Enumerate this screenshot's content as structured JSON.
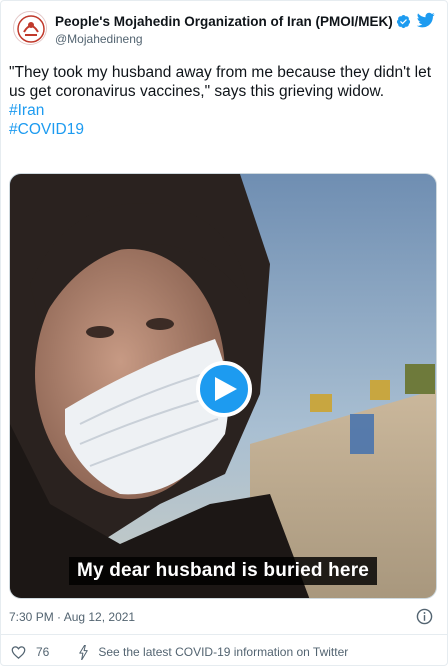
{
  "author": {
    "display_name": "People's Mojahedin Organization of Iran (PMOI/MEK)",
    "handle": "@Mojahedineng",
    "verified": true
  },
  "tweet": {
    "text": "\"They took my husband away from me because they didn't let us get coronavirus vaccines,\" says this grieving widow.",
    "hashtags": [
      "#Iran",
      "#COVID19"
    ]
  },
  "media": {
    "subtitle": "My dear husband is buried here"
  },
  "meta": {
    "timestamp": "7:30 PM · Aug 12, 2021"
  },
  "actions": {
    "like_count": "76",
    "covid_info_label": "See the latest COVID-19 information on Twitter"
  },
  "colors": {
    "link": "#1d9bf0",
    "muted": "#536471",
    "verified": "#1d9bf0",
    "play_button": "#1d9bf0"
  },
  "icons": [
    "org-logo-avatar",
    "verified-badge-icon",
    "twitter-bird-icon",
    "play-icon",
    "info-icon",
    "heart-icon",
    "lightning-icon"
  ]
}
